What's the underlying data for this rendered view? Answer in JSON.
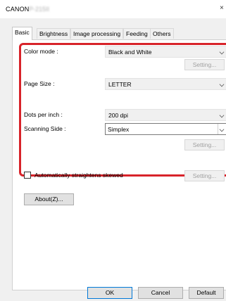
{
  "window": {
    "title": "CANON",
    "model": "P-215II",
    "close_glyph": "×"
  },
  "tabs": [
    {
      "label": "Basic",
      "active": true
    },
    {
      "label": "Brightness",
      "active": false
    },
    {
      "label": "Image processing",
      "active": false
    },
    {
      "label": "Feeding",
      "active": false
    },
    {
      "label": "Others",
      "active": false
    }
  ],
  "basic": {
    "color_mode": {
      "label": "Color mode :",
      "value": "Black and White"
    },
    "color_setting_button": "Setting...",
    "page_size": {
      "label": "Page Size :",
      "value": "LETTER"
    },
    "dpi": {
      "label": "Dots per inch :",
      "value": "200 dpi"
    },
    "scanning_side": {
      "label": "Scanning Side :",
      "value": "Simplex"
    },
    "side_setting_button": "Setting...",
    "straighten": {
      "label": "Automatically straightens skewed",
      "checked": false
    },
    "straighten_setting_button": "Setting...",
    "about_button": "About(Z)..."
  },
  "footer": {
    "ok": "OK",
    "cancel": "Cancel",
    "default": "Default"
  },
  "colors": {
    "highlight_border": "#d8232a",
    "focus_border": "#0078d7"
  }
}
